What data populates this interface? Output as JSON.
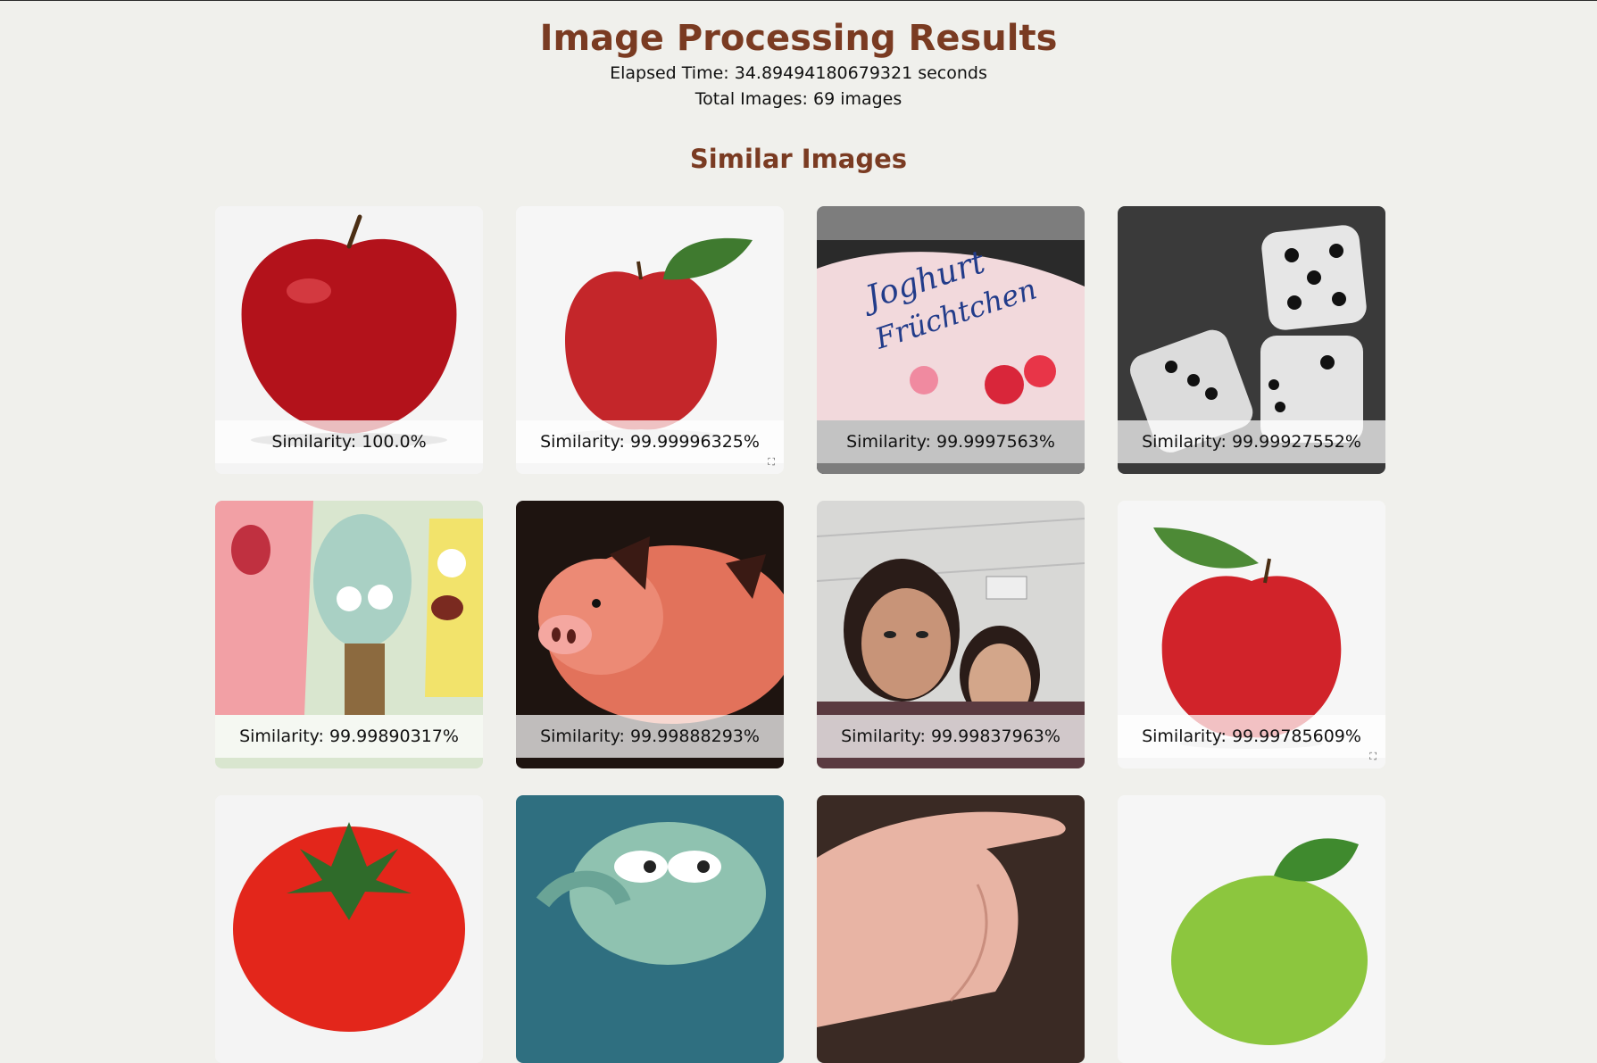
{
  "header": {
    "title": "Image Processing Results",
    "elapsed": "Elapsed Time: 34.89494180679321 seconds",
    "total": "Total Images: 69 images"
  },
  "section_title": "Similar Images",
  "cards": [
    {
      "subject": "red-apple-icon",
      "caption": "Similarity: 100.0%"
    },
    {
      "subject": "red-apple-leaf-icon",
      "caption": "Similarity: 99.99996325%"
    },
    {
      "subject": "candy-bag-icon",
      "caption": "Similarity: 99.9997563%"
    },
    {
      "subject": "dice-icon",
      "caption": "Similarity: 99.99927552%"
    },
    {
      "subject": "cartoon-characters-icon",
      "caption": "Similarity: 99.99890317%"
    },
    {
      "subject": "pig-icon",
      "caption": "Similarity: 99.99888293%"
    },
    {
      "subject": "selfie-people-icon",
      "caption": "Similarity: 99.99837963%"
    },
    {
      "subject": "red-apple-leaf-icon",
      "caption": "Similarity: 99.99785609%"
    },
    {
      "subject": "tomato-icon",
      "caption": ""
    },
    {
      "subject": "cartoon-squid-icon",
      "caption": ""
    },
    {
      "subject": "hand-icon",
      "caption": ""
    },
    {
      "subject": "green-apple-icon",
      "caption": ""
    }
  ]
}
